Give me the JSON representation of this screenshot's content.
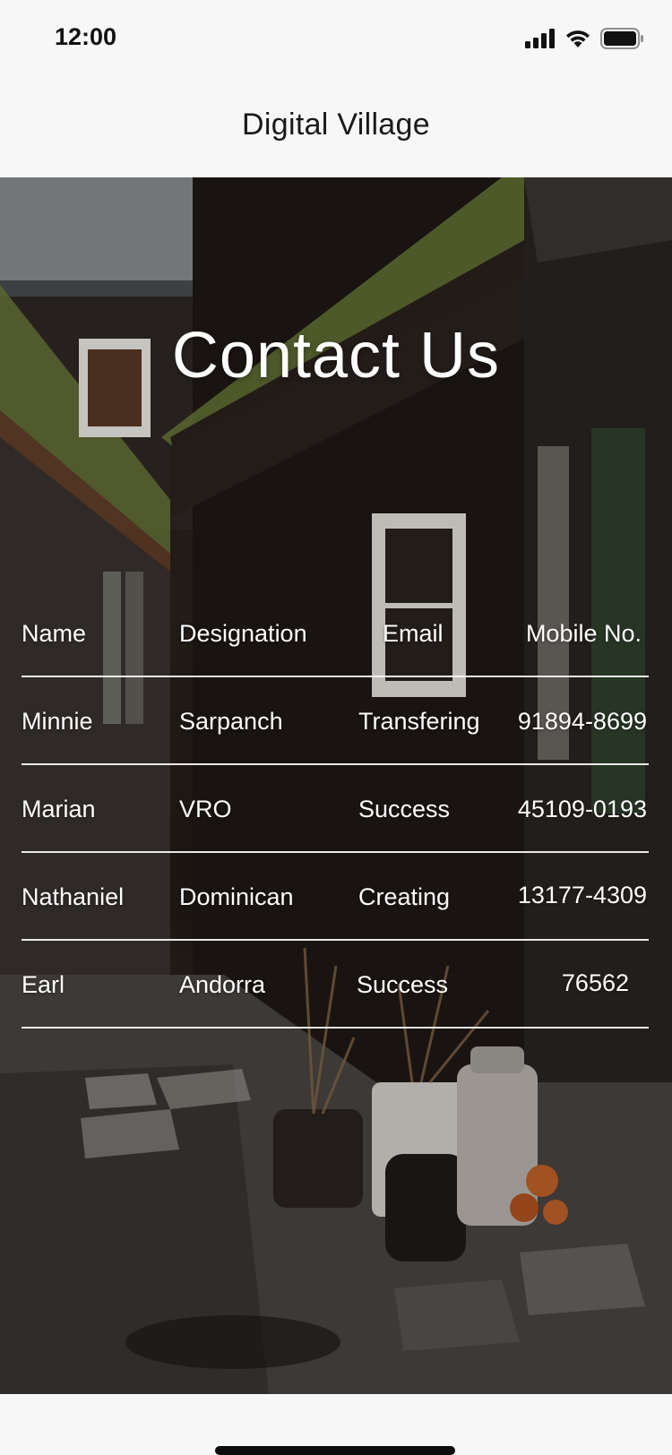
{
  "status_bar": {
    "time": "12:00"
  },
  "app_bar": {
    "title": "Digital Village"
  },
  "page": {
    "heading": "Contact Us"
  },
  "table": {
    "headers": {
      "name": "Name",
      "designation": "Designation",
      "email": "Email",
      "mobile": "Mobile No."
    },
    "rows": [
      {
        "name": "Minnie",
        "designation": "Sarpanch",
        "email": "Transfering",
        "mobile": "91894-8699"
      },
      {
        "name": "Marian",
        "designation": "VRO",
        "email": "Success",
        "mobile": "45109-0193"
      },
      {
        "name": "Nathaniel",
        "designation": "Dominican",
        "email": "Creating",
        "mobile": "13177-4309"
      },
      {
        "name": "Earl",
        "designation": "Andorra",
        "email": "Success",
        "mobile": "76562"
      }
    ]
  },
  "icons": {
    "signal": "cellular-signal-icon",
    "wifi": "wifi-icon",
    "battery": "battery-icon"
  },
  "colors": {
    "app_background": "#f7f7f7",
    "text_on_image": "#ffffff",
    "title_text": "#1a1a1a"
  }
}
